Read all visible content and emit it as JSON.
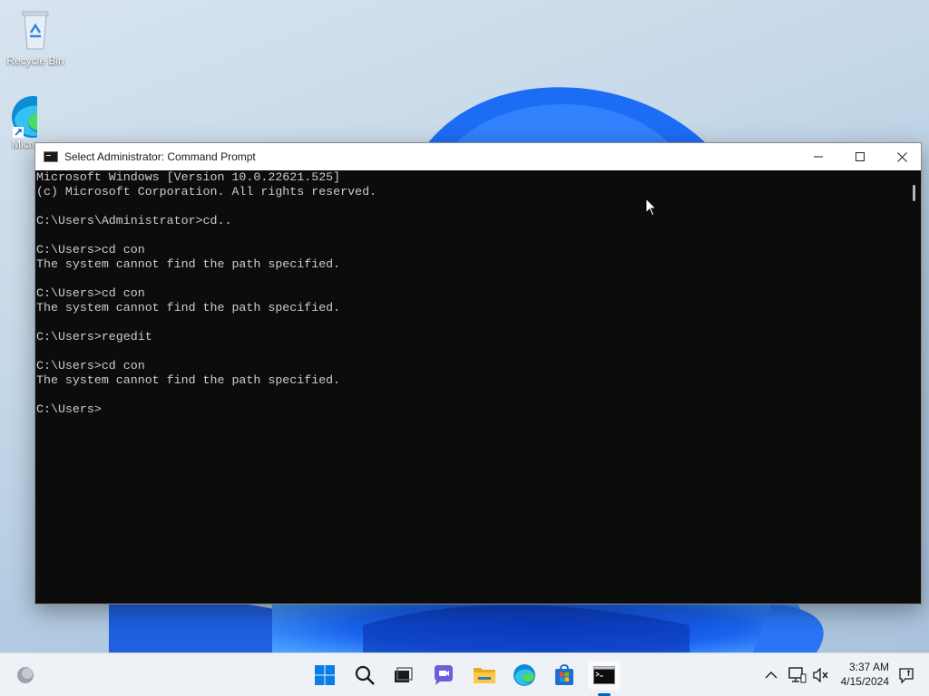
{
  "desktop": {
    "icons": [
      {
        "label": "Recycle Bin",
        "icon": "recycle-bin-icon"
      },
      {
        "label": "Microsoft Edge",
        "icon": "edge-icon"
      }
    ]
  },
  "window": {
    "title": "Select Administrator: Command Prompt",
    "app_icon": "cmd-icon",
    "controls": {
      "minimize": "minimize-icon",
      "maximize": "maximize-icon",
      "close": "close-icon"
    }
  },
  "console": {
    "lines": [
      "Microsoft Windows [Version 10.0.22621.525]",
      "(c) Microsoft Corporation. All rights reserved.",
      "",
      "C:\\Users\\Administrator>cd..",
      "",
      "C:\\Users>cd con",
      "The system cannot find the path specified.",
      "",
      "C:\\Users>cd con",
      "The system cannot find the path specified.",
      "",
      "C:\\Users>regedit",
      "",
      "C:\\Users>cd con",
      "The system cannot find the path specified.",
      "",
      "C:\\Users>"
    ]
  },
  "taskbar": {
    "items": [
      {
        "name": "start",
        "icon": "windows-start-icon"
      },
      {
        "name": "search",
        "icon": "search-icon"
      },
      {
        "name": "task-view",
        "icon": "task-view-icon"
      },
      {
        "name": "chat",
        "icon": "chat-icon"
      },
      {
        "name": "file-explorer",
        "icon": "folder-icon"
      },
      {
        "name": "edge",
        "icon": "edge-icon"
      },
      {
        "name": "store",
        "icon": "store-icon"
      },
      {
        "name": "command-prompt",
        "icon": "cmd-icon",
        "active": true
      }
    ],
    "tray": {
      "time": "3:37 AM",
      "date": "4/15/2024"
    }
  },
  "colors": {
    "console_bg": "#0c0c0c",
    "console_fg": "#cccccc",
    "accent": "#0067c0"
  }
}
